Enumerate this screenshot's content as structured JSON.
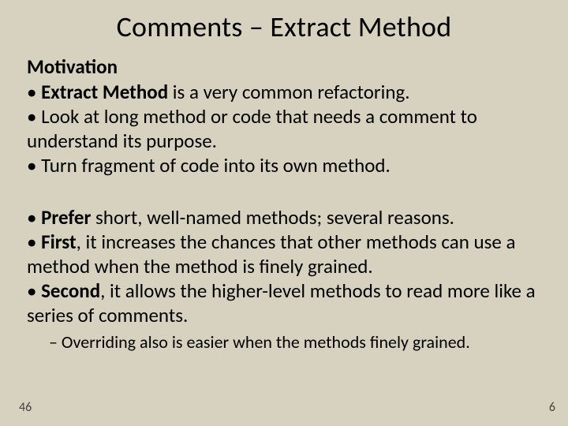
{
  "title": "Comments – Extract Method",
  "motivation_label": "Motivation",
  "b1_pre": "• ",
  "b1_bold": "Extract Method",
  "b1_post": " is a very common refactoring.",
  "b2": "•  Look at long method or code that needs a comment to understand its purpose.",
  "b3": "•  Turn fragment of code into its own method.",
  "b4_pre": "• ",
  "b4_bold": "Prefer",
  "b4_post": " short, well-named methods; several reasons.",
  "b5_pre": "• ",
  "b5_bold": "First",
  "b5_post": ", it increases the chances that other methods can use a method when the method is finely grained.",
  "b6_pre": "• ",
  "b6_bold": "Second",
  "b6_post": ", it allows the higher-level methods to read more like a series of comments.",
  "sub1": "–  Overriding also is easier when the methods finely grained.",
  "page_left": "46",
  "page_right": "6"
}
